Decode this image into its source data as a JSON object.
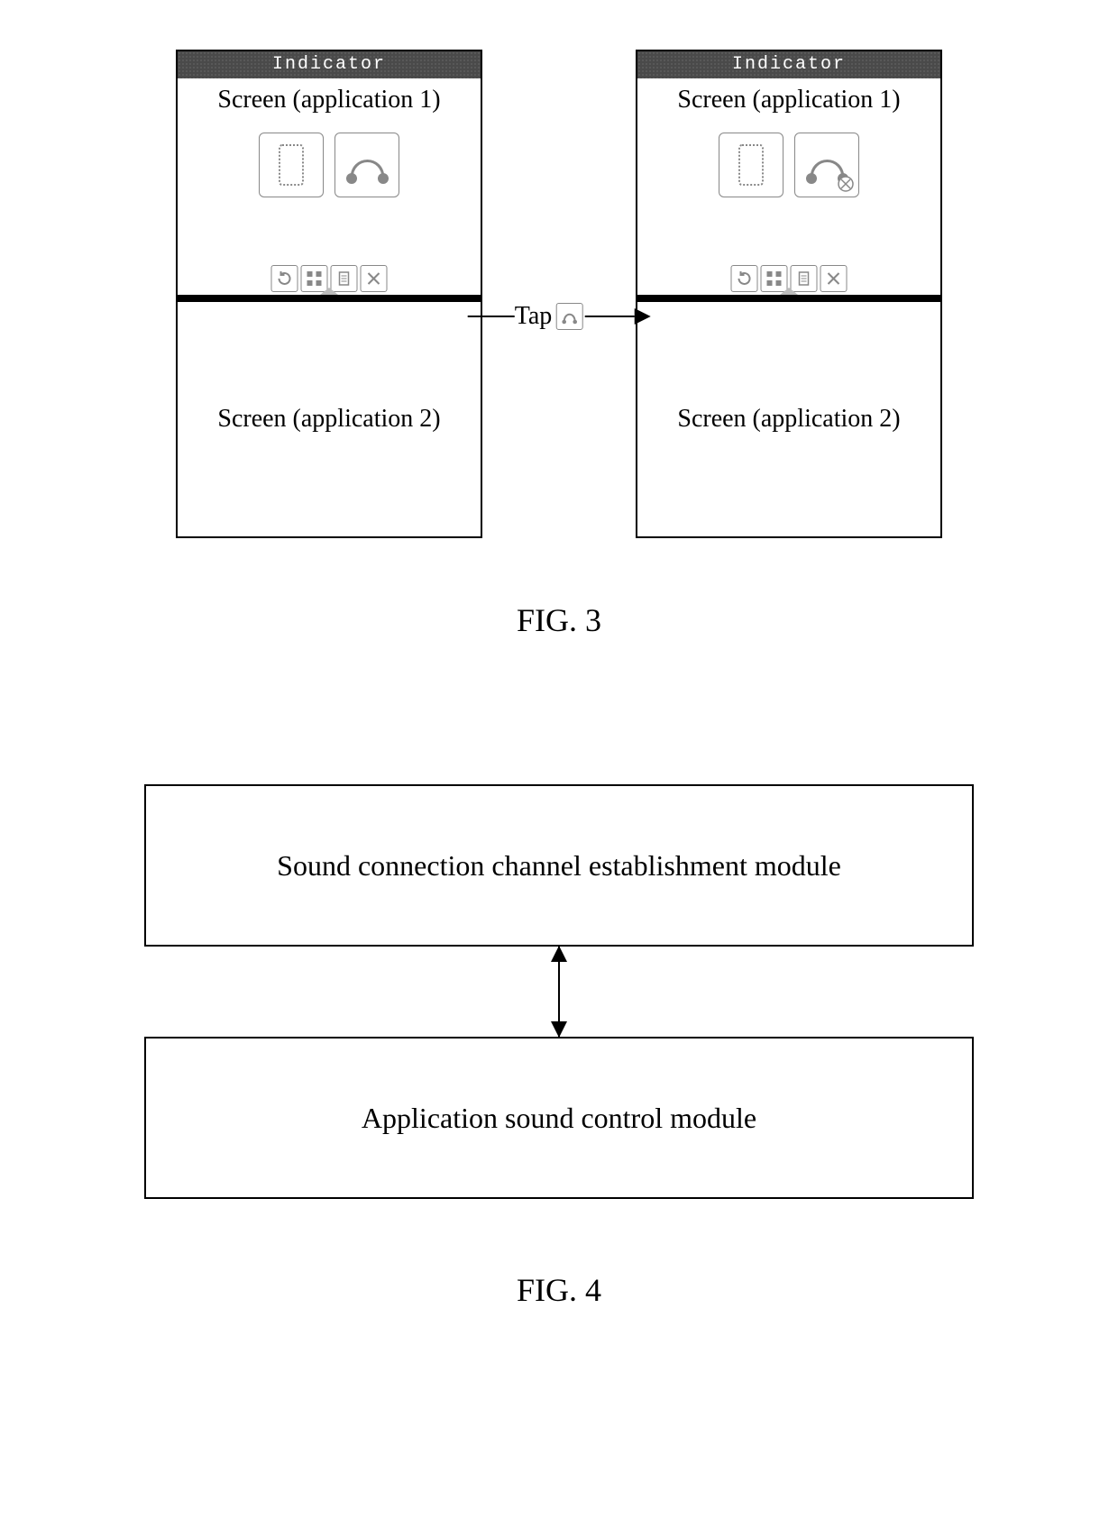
{
  "fig3": {
    "phone_left": {
      "indicator": "Indicator",
      "screen1_label": "Screen (application 1)",
      "screen2_label": "Screen (application 2)",
      "headphone_disabled": false
    },
    "phone_right": {
      "indicator": "Indicator",
      "screen1_label": "Screen (application 1)",
      "screen2_label": "Screen (application 2)",
      "headphone_disabled": true
    },
    "tap_label": "Tap",
    "caption": "FIG. 3",
    "toolbar_icons": [
      "refresh",
      "grid",
      "document",
      "close"
    ],
    "big_icons": [
      "phone-outline",
      "headphones"
    ]
  },
  "fig4": {
    "box1": "Sound connection channel establishment module",
    "box2": "Application sound control module",
    "caption": "FIG. 4"
  }
}
